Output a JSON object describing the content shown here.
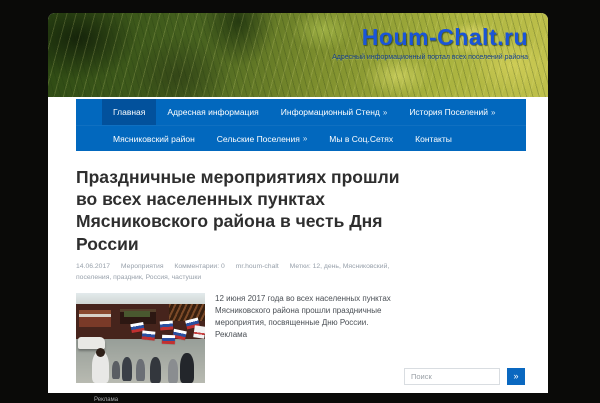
{
  "page": {
    "background_color": "#0a0a08",
    "container_color": "#ffffff"
  },
  "header": {
    "site_title": "Houm-Chalt.ru",
    "tagline": "Адресный информационный портал всех поселений района",
    "title_color": "#1a55d9"
  },
  "nav": {
    "accent_color": "#0268be",
    "active_color": "#02519c",
    "submenu_indicator": "»",
    "rows": [
      {
        "items": [
          {
            "label": "Главная",
            "active": true
          },
          {
            "label": "Адресная информация"
          },
          {
            "label": "Информационный Стенд",
            "submenu": true
          },
          {
            "label": "История Поселений",
            "submenu": true
          }
        ]
      },
      {
        "items": [
          {
            "label": "Мясниковский район"
          },
          {
            "label": "Сельские Поселения",
            "submenu": true
          },
          {
            "label": "Мы в Соц.Сетях"
          },
          {
            "label": "Контакты"
          }
        ]
      }
    ]
  },
  "article": {
    "title": "Праздничные мероприятиях прошли во всех населенных пунктах Мясниковского района в честь Дня России",
    "meta": {
      "date": "14.06.2017",
      "category": "Мероприятия",
      "comments": "Комментарии: 0",
      "author": "mr.houm-chalt",
      "tags": "Метки: 12, день, Мясниковский, поселения, праздник, Россия, частушки"
    },
    "body": "12 июня 2017 года во всех населенных пунктах Мясниковского района прошли праздничные мероприятия, посвященные Дню России. Реклама",
    "ad_label": "Реклама"
  },
  "search": {
    "placeholder": "Поиск",
    "button_label": "»"
  }
}
